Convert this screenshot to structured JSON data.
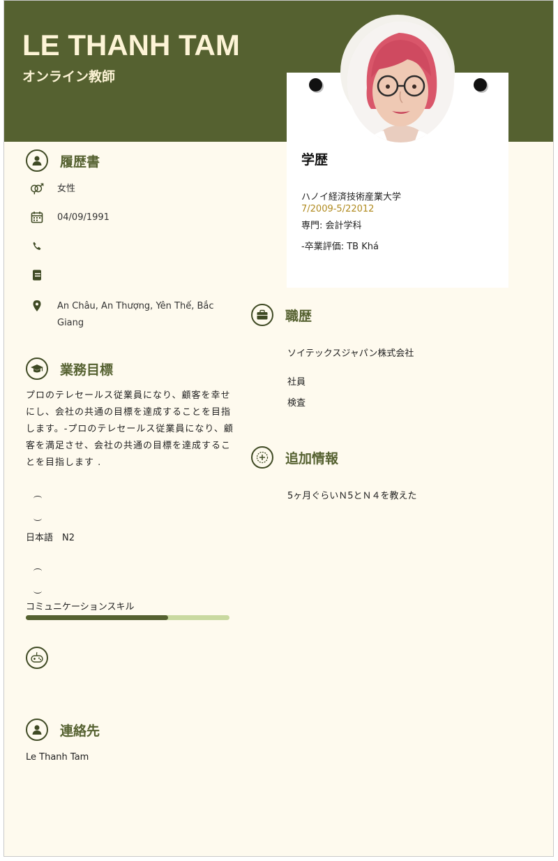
{
  "header": {
    "name": "LE THANH TAM",
    "job_title": "オンライン教師"
  },
  "education": {
    "title": "学歴",
    "school": "ハノイ経済技術産業大学",
    "period": "7/2009-5/22012",
    "major": "専門: 会計学科",
    "grade": "-卒業評価: TB Khá"
  },
  "profile": {
    "title": "履歴書",
    "gender": "女性",
    "birthday": "04/09/1991",
    "phone": "",
    "email": "",
    "address": "An  Châu, An Thượng, Yên Thế, Bắc Giang"
  },
  "objective": {
    "title": "業務目標",
    "text": "プロのテレセールス従業員になり、顧客を幸せにし、会社の共通の目標を達成することを目指します。-プロのテレセールス従業員になり、顧客を満足させ、会社の共通の目標を達成することを目指します ."
  },
  "skills": {
    "items": [
      {
        "label": "日本語　N2"
      },
      {
        "label": "コミュニケーションスキル",
        "level": 0.7
      }
    ]
  },
  "hobbies": {
    "title": ""
  },
  "contact": {
    "title": "連絡先",
    "name": "Le Thanh Tam"
  },
  "experience": {
    "title": "職歴",
    "company": "ソイテックスジャパン株式会社",
    "position": "社員",
    "duty": "検査"
  },
  "additional": {
    "title": "追加情報",
    "text": "5ヶ月ぐらいＮ5とＮ４を教えた"
  },
  "colors": {
    "header_bg": "#556130",
    "accent": "#556130",
    "page_bg": "#fefaee",
    "skill_track": "#c9d9a0",
    "date_gold": "#b08a1e"
  },
  "icons": [
    "user-icon",
    "gender-icon",
    "calendar-icon",
    "phone-icon",
    "email-icon",
    "location-icon",
    "graduation-cap-icon",
    "gamepad-icon",
    "briefcase-icon",
    "plus-circle-icon"
  ]
}
